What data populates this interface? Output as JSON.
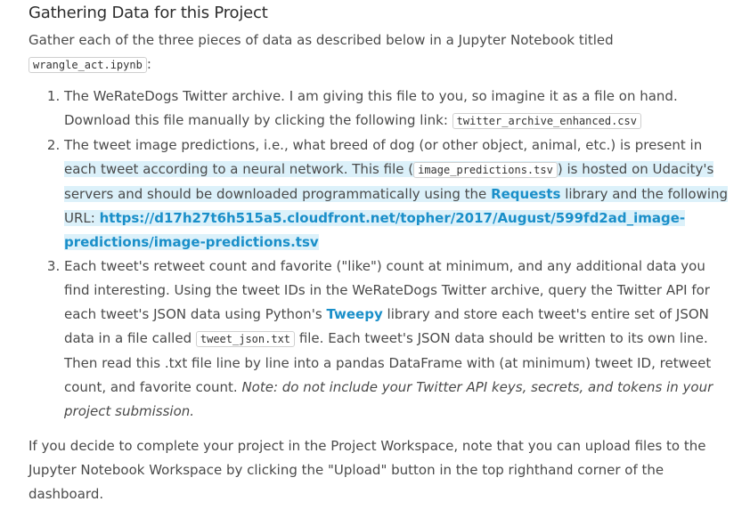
{
  "heading": "Gathering Data for this Project",
  "intro": {
    "text": "Gather each of the three pieces of data as described below in a Jupyter Notebook titled",
    "code": "wrangle_act.ipynb",
    "suffix": ":"
  },
  "items": [
    {
      "text1": "The WeRateDogs Twitter archive. I am giving this file to you, so imagine it as a file on hand. Download this file manually by clicking the following link:",
      "code": "twitter_archive_enhanced.csv"
    },
    {
      "text1": "The tweet image predictions, i.e., what breed of dog (or other object, animal, etc.) is present in",
      "text2": "each tweet according to a neural network. This file (",
      "code": "image_predictions.tsv",
      "text3": ") is hosted on Udacity's servers and should be downloaded programmatically using the",
      "link1": "Requests",
      "text4": "library and the following URL:",
      "url": "https://d17h27t6h515a5.cloudfront.net/topher/2017/August/599fd2ad_image-predictions/image-predictions.tsv"
    },
    {
      "text1": "Each tweet's retweet count and favorite (\"like\") count at minimum, and any additional data you find interesting. Using the tweet IDs in the WeRateDogs Twitter archive, query the Twitter API for each tweet's JSON data using Python's",
      "link1": "Tweepy",
      "text2": "library and store each tweet's entire set of JSON data in a file called",
      "code": "tweet_json.txt",
      "text3": "file. Each tweet's JSON data should be written to its own line. Then read this .txt file line by line into a pandas DataFrame with (at minimum) tweet ID, retweet count, and favorite count.",
      "note": "Note: do not include your Twitter API keys, secrets, and tokens in your project submission."
    }
  ],
  "outro": "If you decide to complete your project in the Project Workspace, note that you can upload files to the Jupyter Notebook Workspace by clicking the \"Upload\" button in the top righthand corner of the dashboard.",
  "colors": {
    "link": "#1a8fc9",
    "highlight": "#dcf1fa",
    "text": "#4a4a4a"
  }
}
